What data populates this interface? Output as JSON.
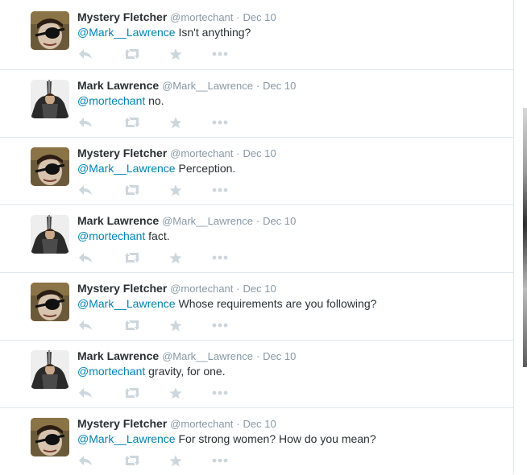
{
  "tweets": [
    {
      "author": "mystery",
      "name": "Mystery Fletcher",
      "handle": "@mortechant",
      "sep": "·",
      "date": "Dec 10",
      "mention": "@Mark__Lawrence",
      "text": " Isn't anything?"
    },
    {
      "author": "mark",
      "name": "Mark Lawrence",
      "handle": "@Mark__Lawrence",
      "sep": "·",
      "date": "Dec 10",
      "mention": "@mortechant",
      "text": " no."
    },
    {
      "author": "mystery",
      "name": "Mystery Fletcher",
      "handle": "@mortechant",
      "sep": "·",
      "date": "Dec 10",
      "mention": "@Mark__Lawrence",
      "text": " Perception."
    },
    {
      "author": "mark",
      "name": "Mark Lawrence",
      "handle": "@Mark__Lawrence",
      "sep": "·",
      "date": "Dec 10",
      "mention": "@mortechant",
      "text": " fact."
    },
    {
      "author": "mystery",
      "name": "Mystery Fletcher",
      "handle": "@mortechant",
      "sep": "·",
      "date": "Dec 10",
      "mention": "@Mark__Lawrence",
      "text": " Whose requirements are you following?"
    },
    {
      "author": "mark",
      "name": "Mark Lawrence",
      "handle": "@Mark__Lawrence",
      "sep": "·",
      "date": "Dec 10",
      "mention": "@mortechant",
      "text": " gravity, for one."
    },
    {
      "author": "mystery",
      "name": "Mystery Fletcher",
      "handle": "@mortechant",
      "sep": "·",
      "date": "Dec 10",
      "mention": "@Mark__Lawrence",
      "text": " For strong women? How do you mean?"
    }
  ],
  "icons": {
    "reply": "reply-icon",
    "retweet": "retweet-icon",
    "favorite": "star-icon",
    "more": "more-icon"
  },
  "colors": {
    "name": "#292f33",
    "meta": "#8899a6",
    "mention": "#0084b4",
    "action_icon": "#ccd6dd",
    "divider": "#e1e8ed"
  }
}
